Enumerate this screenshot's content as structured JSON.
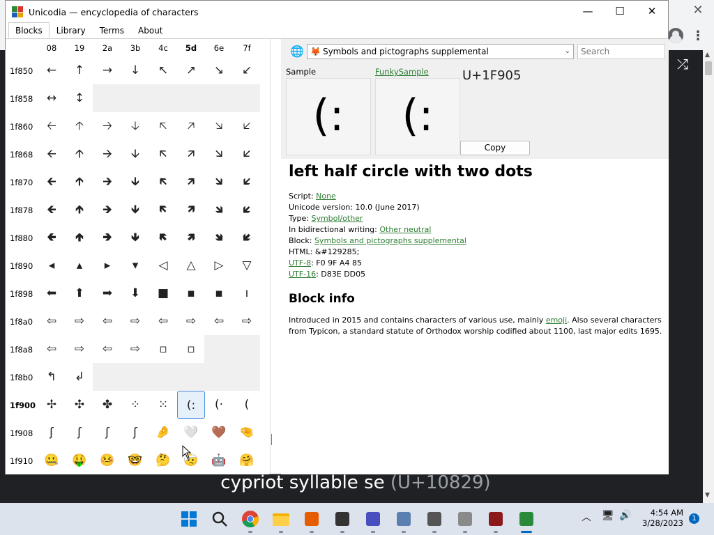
{
  "background_app": {
    "close_glyph": "✕",
    "menu_glyph": "⋮",
    "shuffle_glyph": "⤮",
    "caption_name": "cypriot syllable se ",
    "caption_code": "(U+10829)"
  },
  "window": {
    "title": "Unicodia — encyclopedia of characters",
    "minimize": "—",
    "maximize": "☐",
    "close": "✕"
  },
  "tabs": [
    {
      "label": "Blocks",
      "active": true
    },
    {
      "label": "Library",
      "active": false
    },
    {
      "label": "Terms",
      "active": false
    },
    {
      "label": "About",
      "active": false
    }
  ],
  "grid": {
    "columns": [
      {
        "label": "08",
        "bold": false
      },
      {
        "label": "19",
        "bold": false
      },
      {
        "label": "2a",
        "bold": false
      },
      {
        "label": "3b",
        "bold": false
      },
      {
        "label": "4c",
        "bold": false
      },
      {
        "label": "5d",
        "bold": true
      },
      {
        "label": "6e",
        "bold": false
      },
      {
        "label": "7f",
        "bold": false
      }
    ],
    "rows": [
      {
        "label": "1f850",
        "bold": false,
        "cells": [
          "←",
          "↑",
          "→",
          "↓",
          "↖",
          "↗",
          "↘",
          "↙"
        ]
      },
      {
        "label": "1f858",
        "bold": false,
        "cells": [
          "↔",
          "↕",
          "",
          "",
          "",
          "",
          "",
          ""
        ]
      },
      {
        "label": "1f860",
        "bold": false,
        "cells": [
          "🡠",
          "🡡",
          "🡢",
          "🡣",
          "🡤",
          "🡥",
          "🡦",
          "🡧"
        ]
      },
      {
        "label": "1f868",
        "bold": false,
        "cells": [
          "🡨",
          "🡩",
          "🡪",
          "🡫",
          "🡬",
          "🡭",
          "🡮",
          "🡯"
        ]
      },
      {
        "label": "1f870",
        "bold": false,
        "cells": [
          "🡰",
          "🡱",
          "🡲",
          "🡳",
          "🡴",
          "🡵",
          "🡶",
          "🡷"
        ]
      },
      {
        "label": "1f878",
        "bold": false,
        "cells": [
          "🡸",
          "🡹",
          "🡺",
          "🡻",
          "🡼",
          "🡽",
          "🡾",
          "🡿"
        ]
      },
      {
        "label": "1f880",
        "bold": false,
        "cells": [
          "🢀",
          "🢁",
          "🢂",
          "🢃",
          "🢄",
          "🢅",
          "🢆",
          "🢇"
        ]
      },
      {
        "label": "1f890",
        "bold": false,
        "cells": [
          "◂",
          "▴",
          "▸",
          "▾",
          "◁",
          "△",
          "▷",
          "▽"
        ]
      },
      {
        "label": "1f898",
        "bold": false,
        "cells": [
          "⬅",
          "⬆",
          "➡",
          "⬇",
          "■",
          "▪",
          "▪",
          "ı"
        ]
      },
      {
        "label": "1f8a0",
        "bold": false,
        "cells": [
          "⇦",
          "⇨",
          "⇦",
          "⇨",
          "⇦",
          "⇨",
          "⇦",
          "⇨"
        ]
      },
      {
        "label": "1f8a8",
        "bold": false,
        "cells": [
          "⇦",
          "⇨",
          "⇦",
          "⇨",
          "▫",
          "▫",
          "",
          ""
        ]
      },
      {
        "label": "1f8b0",
        "bold": false,
        "cells": [
          "↰",
          "↲",
          "",
          "",
          "",
          "",
          "",
          ""
        ]
      },
      {
        "label": "1f900",
        "bold": true,
        "cells": [
          "✢",
          "✣",
          "✤",
          "⁘",
          "⁙",
          "(:",
          "(·",
          "("
        ]
      },
      {
        "label": "1f908",
        "bold": false,
        "cells": [
          "ʃ",
          "ʃ",
          "ʃ",
          "ʃ",
          "🤌",
          "🤍",
          "🤎",
          "🤏"
        ]
      },
      {
        "label": "1f910",
        "bold": false,
        "cells": [
          "🤐",
          "🤑",
          "🤒",
          "🤓",
          "🤔",
          "🤕",
          "🤖",
          "🤗"
        ]
      }
    ]
  },
  "toolbar": {
    "globe_glyph": "🌐",
    "block_icon": "🦊",
    "block_name": "Symbols and pictographs supplemental",
    "chevron": "⌄",
    "search_placeholder": "Search"
  },
  "sample": {
    "label": "Sample",
    "funky_label": "FunkySample",
    "glyph": "(:",
    "codepoint": "U+1F905",
    "copy_label": "Copy"
  },
  "details": {
    "name": "left half circle with two dots",
    "script_label": "Script: ",
    "script_value": "None",
    "version_text": "Unicode version: 10.0 (June 2017)",
    "type_label": "Type: ",
    "type_value": "Symbol/other",
    "bidi_label": "In bidirectional writing: ",
    "bidi_value": "Other neutral",
    "block_label": "Block: ",
    "block_value": "Symbols and pictographs supplemental",
    "html_text": "HTML: &#129285;",
    "utf8_label": "UTF-8",
    "utf8_value": ": F0 9F A4 85",
    "utf16_label": "UTF-16",
    "utf16_value": ": D83E DD05",
    "block_info_heading": "Block info",
    "block_info_1": "Introduced in 2015 and contains characters of various use, mainly ",
    "block_info_link": "emoji",
    "block_info_2": ". Also several characters from Typicon, a standard statute of Orthodox worship codified about 1100, last major edits 1695."
  },
  "taskbar": {
    "time": "4:54 AM",
    "date": "3/28/2023",
    "notification_count": "1",
    "apps": [
      "start-icon",
      "search-icon",
      "chrome-icon",
      "file-explorer-icon",
      "search-tool-icon",
      "7zip-icon",
      "inkscape-icon",
      "cloud-icon",
      "settings-icon",
      "clipboard-icon",
      "winrar-icon",
      "unicodia-icon"
    ]
  },
  "colors": {
    "link": "#2e7d32",
    "selection": "#4a90d9",
    "accent": "#0067c0"
  }
}
